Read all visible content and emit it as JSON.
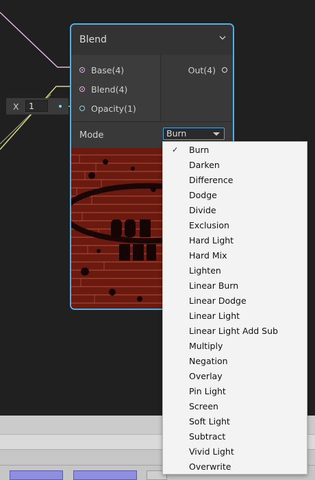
{
  "node": {
    "title": "Blend",
    "inputs": [
      {
        "label": "Base(4)"
      },
      {
        "label": "Blend(4)"
      },
      {
        "label": "Opacity(1)"
      }
    ],
    "output": {
      "label": "Out(4)"
    },
    "mode_label": "Mode",
    "mode_value": "Burn"
  },
  "opacity_input": {
    "label": "X",
    "value": "1"
  },
  "dropdown": {
    "selected": "Burn",
    "options": [
      "Burn",
      "Darken",
      "Difference",
      "Dodge",
      "Divide",
      "Exclusion",
      "Hard Light",
      "Hard Mix",
      "Lighten",
      "Linear Burn",
      "Linear Dodge",
      "Linear Light",
      "Linear Light Add Sub",
      "Multiply",
      "Negation",
      "Overlay",
      "Pin Light",
      "Screen",
      "Soft Light",
      "Subtract",
      "Vivid Light",
      "Overwrite"
    ]
  },
  "colors": {
    "node_border": "#4fb2e6",
    "wire_pink": "#e8b4e8",
    "wire_cyan": "#8fd6e8",
    "wire_yellow": "#d8d88a",
    "canvas_bg": "#202020"
  },
  "icons": {
    "collapse": "chevron-down-icon",
    "preview_collapse": "chevron-up-icon",
    "selected_mark": "check-icon"
  }
}
